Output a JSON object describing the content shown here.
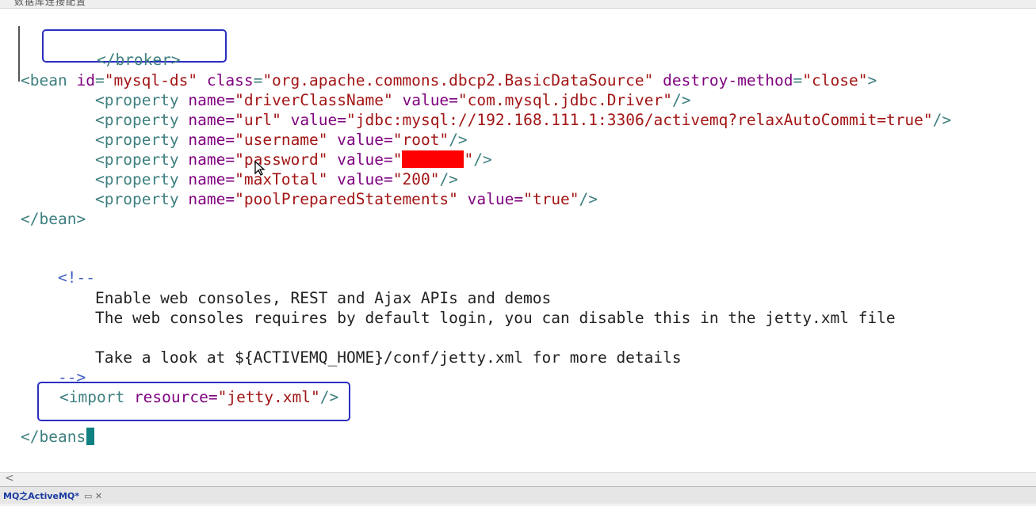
{
  "window": {
    "top_cut_title": "数据库连接配置"
  },
  "editor": {
    "broker_close": "</broker>",
    "bean_open": {
      "lt": "<",
      "tag": "bean",
      "id_attr": "id",
      "id_val": "\"mysql-ds\"",
      "class_attr": "class",
      "class_val": "\"org.apache.commons.dbcp2.BasicDataSource\"",
      "destroy_attr": "destroy-method",
      "destroy_val": "\"close\"",
      "gt": ">"
    },
    "properties": [
      {
        "name": "\"driverClassName\"",
        "value": "\"com.mysql.jdbc.Driver\""
      },
      {
        "name": "\"url\"",
        "value": "\"jdbc:mysql://192.168.111.1:3306/activemq?relaxAutoCommit=true\""
      },
      {
        "name": "\"username\"",
        "value": "\"root\""
      },
      {
        "name": "\"password\"",
        "value": "\""
      },
      {
        "name": "\"maxTotal\"",
        "value": "\"200\""
      },
      {
        "name": "\"poolPreparedStatements\"",
        "value": "\"true\""
      }
    ],
    "property_tag": "<property",
    "name_attr": "name=",
    "value_attr": "value=",
    "self_close": "/>",
    "bean_close": "</bean>",
    "comment_open": "<!--",
    "comment_lines": [
      "Enable web consoles, REST and Ajax APIs and demos",
      "The web consoles requires by default login, you can disable this in the jetty.xml file",
      "",
      "Take a look at ${ACTIVEMQ_HOME}/conf/jetty.xml for more details"
    ],
    "comment_close": "-->",
    "import_line": {
      "tag": "<import",
      "attr": "resource=",
      "val": "\"jetty.xml\"",
      "end": "/>"
    },
    "beans_close": "</beans"
  },
  "scrollbar": {
    "left_arrow": "<"
  },
  "tabbar": {
    "tab_label": "MQ之ActiveMQ*",
    "tab_extra": "▭ ✕"
  }
}
